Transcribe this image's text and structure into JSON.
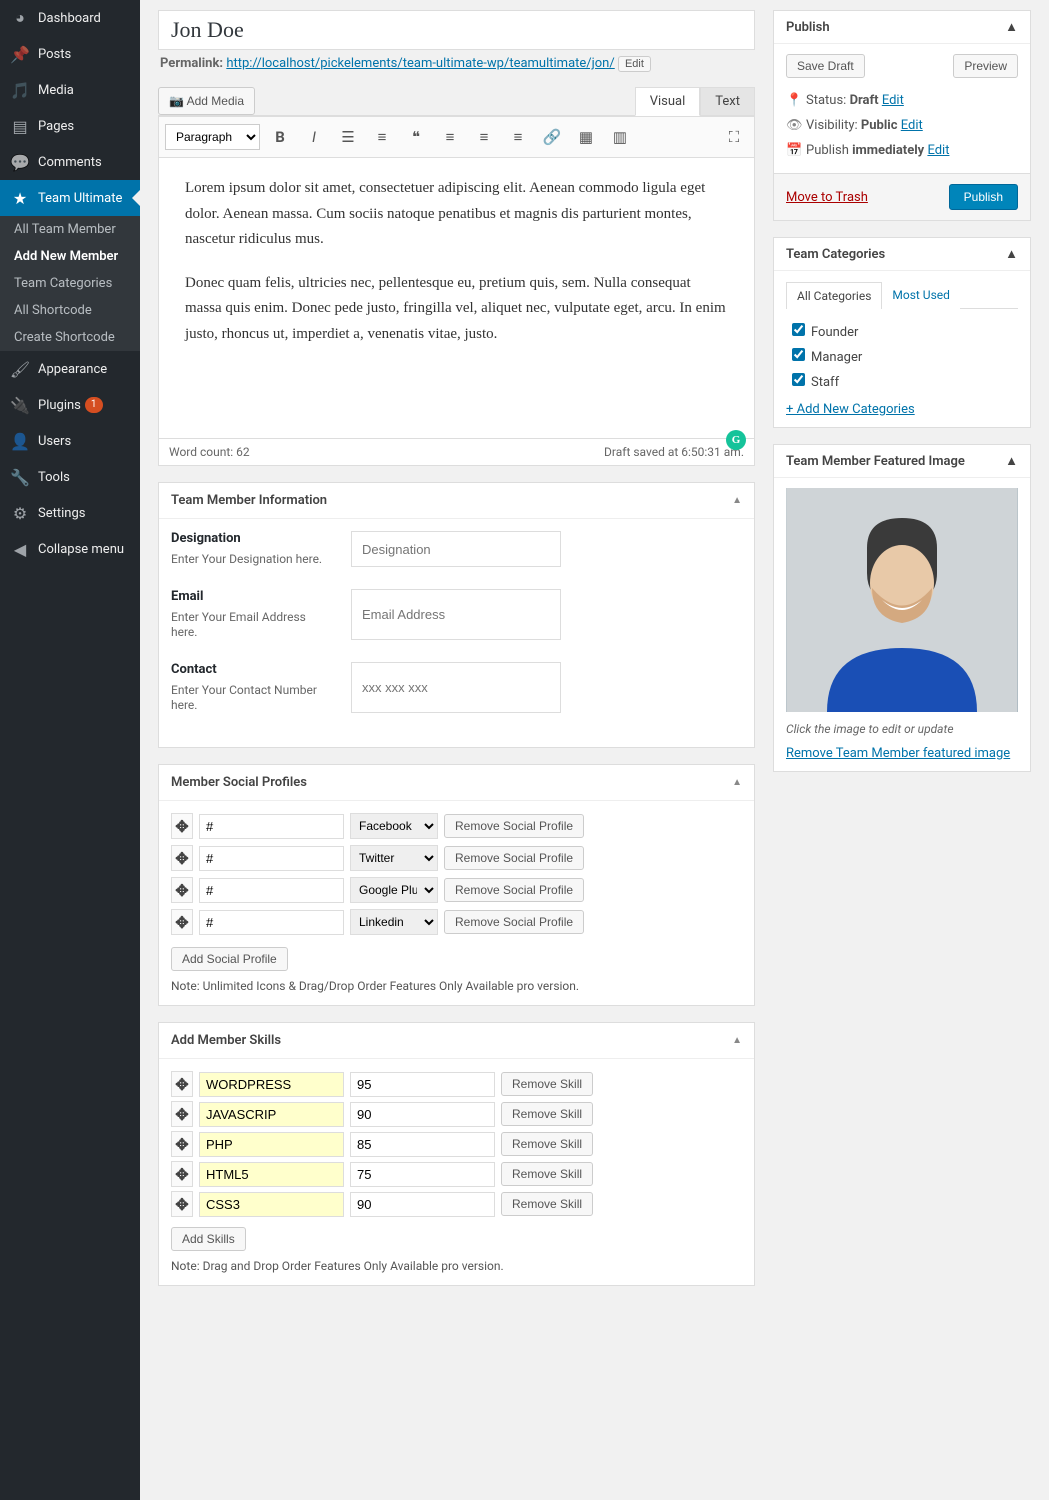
{
  "sidebar": {
    "items": [
      {
        "label": "Dashboard"
      },
      {
        "label": "Posts"
      },
      {
        "label": "Media"
      },
      {
        "label": "Pages"
      },
      {
        "label": "Comments"
      },
      {
        "label": "Team Ultimate"
      },
      {
        "label": "Appearance"
      },
      {
        "label": "Plugins",
        "badge": "1"
      },
      {
        "label": "Users"
      },
      {
        "label": "Tools"
      },
      {
        "label": "Settings"
      },
      {
        "label": "Collapse menu"
      }
    ],
    "sub": [
      {
        "label": "All Team Member"
      },
      {
        "label": "Add New Member"
      },
      {
        "label": "Team Categories"
      },
      {
        "label": "All Shortcode"
      },
      {
        "label": "Create Shortcode"
      }
    ]
  },
  "title": "Jon Doe",
  "permalink": {
    "label": "Permalink:",
    "url": "http://localhost/pickelements/team-ultimate-wp/teamultimate/jon/",
    "edit": "Edit"
  },
  "editor": {
    "addMedia": "Add Media",
    "tabs": {
      "visual": "Visual",
      "text": "Text"
    },
    "format": "Paragraph",
    "body1": "Lorem ipsum dolor sit amet, consectetuer adipiscing elit. Aenean commodo ligula eget dolor. Aenean massa. Cum sociis natoque penatibus et magnis dis parturient montes, nascetur ridiculus mus.",
    "body2": "Donec quam felis, ultricies nec, pellentesque eu, pretium quis, sem. Nulla consequat massa quis enim. Donec pede justo, fringilla vel, aliquet nec, vulputate eget, arcu. In enim justo, rhoncus ut, imperdiet a, venenatis vitae, justo.",
    "wordCount": "Word count: 62",
    "saved": "Draft saved at 6:50:31 am."
  },
  "memberInfo": {
    "title": "Team Member Information",
    "designation": {
      "label": "Designation",
      "help": "Enter Your Designation here.",
      "placeholder": "Designation"
    },
    "email": {
      "label": "Email",
      "help": "Enter Your Email Address here.",
      "placeholder": "Email Address"
    },
    "contact": {
      "label": "Contact",
      "help": "Enter Your Contact Number here.",
      "placeholder": "xxx xxx xxx"
    }
  },
  "social": {
    "title": "Member Social Profiles",
    "rows": [
      {
        "url": "#",
        "net": "Facebook"
      },
      {
        "url": "#",
        "net": "Twitter"
      },
      {
        "url": "#",
        "net": "Google Plus"
      },
      {
        "url": "#",
        "net": "Linkedin"
      }
    ],
    "removeBtn": "Remove Social Profile",
    "addBtn": "Add Social Profile",
    "note": "Note: Unlimited Icons & Drag/Drop Order Features Only Available pro version."
  },
  "skills": {
    "title": "Add Member Skills",
    "rows": [
      {
        "name": "WORDPRESS",
        "val": "95"
      },
      {
        "name": "JAVASCRIP",
        "val": "90"
      },
      {
        "name": "PHP",
        "val": "85"
      },
      {
        "name": "HTML5",
        "val": "75"
      },
      {
        "name": "CSS3",
        "val": "90"
      }
    ],
    "removeBtn": "Remove Skill",
    "addBtn": "Add Skills",
    "note": "Note: Drag and Drop Order Features Only Available pro version."
  },
  "publish": {
    "title": "Publish",
    "saveDraft": "Save Draft",
    "preview": "Preview",
    "statusLabel": "Status:",
    "statusVal": "Draft",
    "visLabel": "Visibility:",
    "visVal": "Public",
    "pubLabel": "Publish",
    "pubVal": "immediately",
    "edit": "Edit",
    "trash": "Move to Trash",
    "publishBtn": "Publish"
  },
  "categories": {
    "title": "Team Categories",
    "allTab": "All Categories",
    "mostTab": "Most Used",
    "items": [
      {
        "label": "Founder",
        "checked": true
      },
      {
        "label": "Manager",
        "checked": true
      },
      {
        "label": "Staff",
        "checked": true
      }
    ],
    "add": "+ Add New Categories"
  },
  "featured": {
    "title": "Team Member Featured Image",
    "hint": "Click the image to edit or update",
    "remove": "Remove Team Member featured image"
  }
}
